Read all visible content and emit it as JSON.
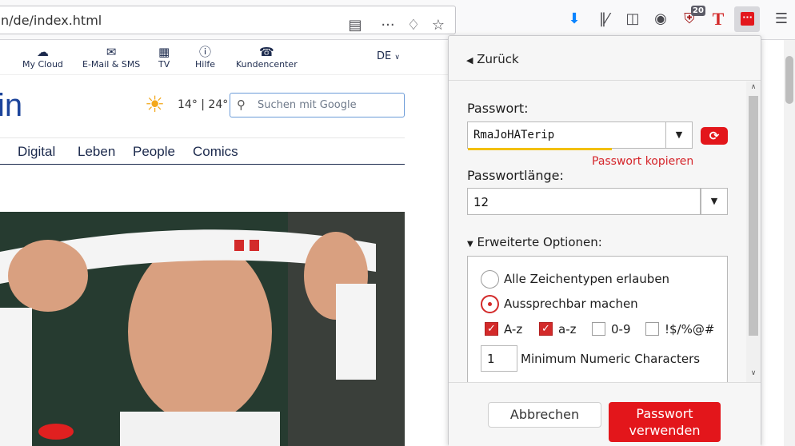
{
  "browser": {
    "url": "n/de/index.html",
    "badge_count": "20"
  },
  "site": {
    "nav": [
      {
        "label": "My Cloud",
        "icon": "cloud-icon"
      },
      {
        "label": "E-Mail & SMS",
        "icon": "mail-icon"
      },
      {
        "label": "TV",
        "icon": "tv-icon"
      },
      {
        "label": "Hilfe",
        "icon": "help-icon"
      },
      {
        "label": "Kundencenter",
        "icon": "support-icon"
      }
    ],
    "lang": "DE",
    "brand_fragment": "in",
    "weather": "14° | 24°",
    "search_placeholder": "Suchen mit Google",
    "categories": [
      "Digital",
      "Leben",
      "People",
      "Comics"
    ]
  },
  "popup": {
    "back": "Zurück",
    "password_label": "Passwort:",
    "password_value": "RmaJoHATerip",
    "copy_link": "Passwort kopieren",
    "length_label": "Passwortlänge:",
    "length_value": "12",
    "advanced_label": "Erweiterte Optionen:",
    "radio_all": "Alle Zeichentypen erlauben",
    "radio_pronounceable": "Aussprechbar machen",
    "cb_upper": "A-z",
    "cb_lower": "a-z",
    "cb_digits": "0-9",
    "cb_symbols": "!$/%@#",
    "min_numeric_value": "1",
    "min_numeric_label": "Minimum Numeric Characters",
    "cancel": "Abbrechen",
    "use": "Passwort verwenden"
  },
  "colors": {
    "accent": "#e3161b",
    "brand": "#1c449b"
  }
}
